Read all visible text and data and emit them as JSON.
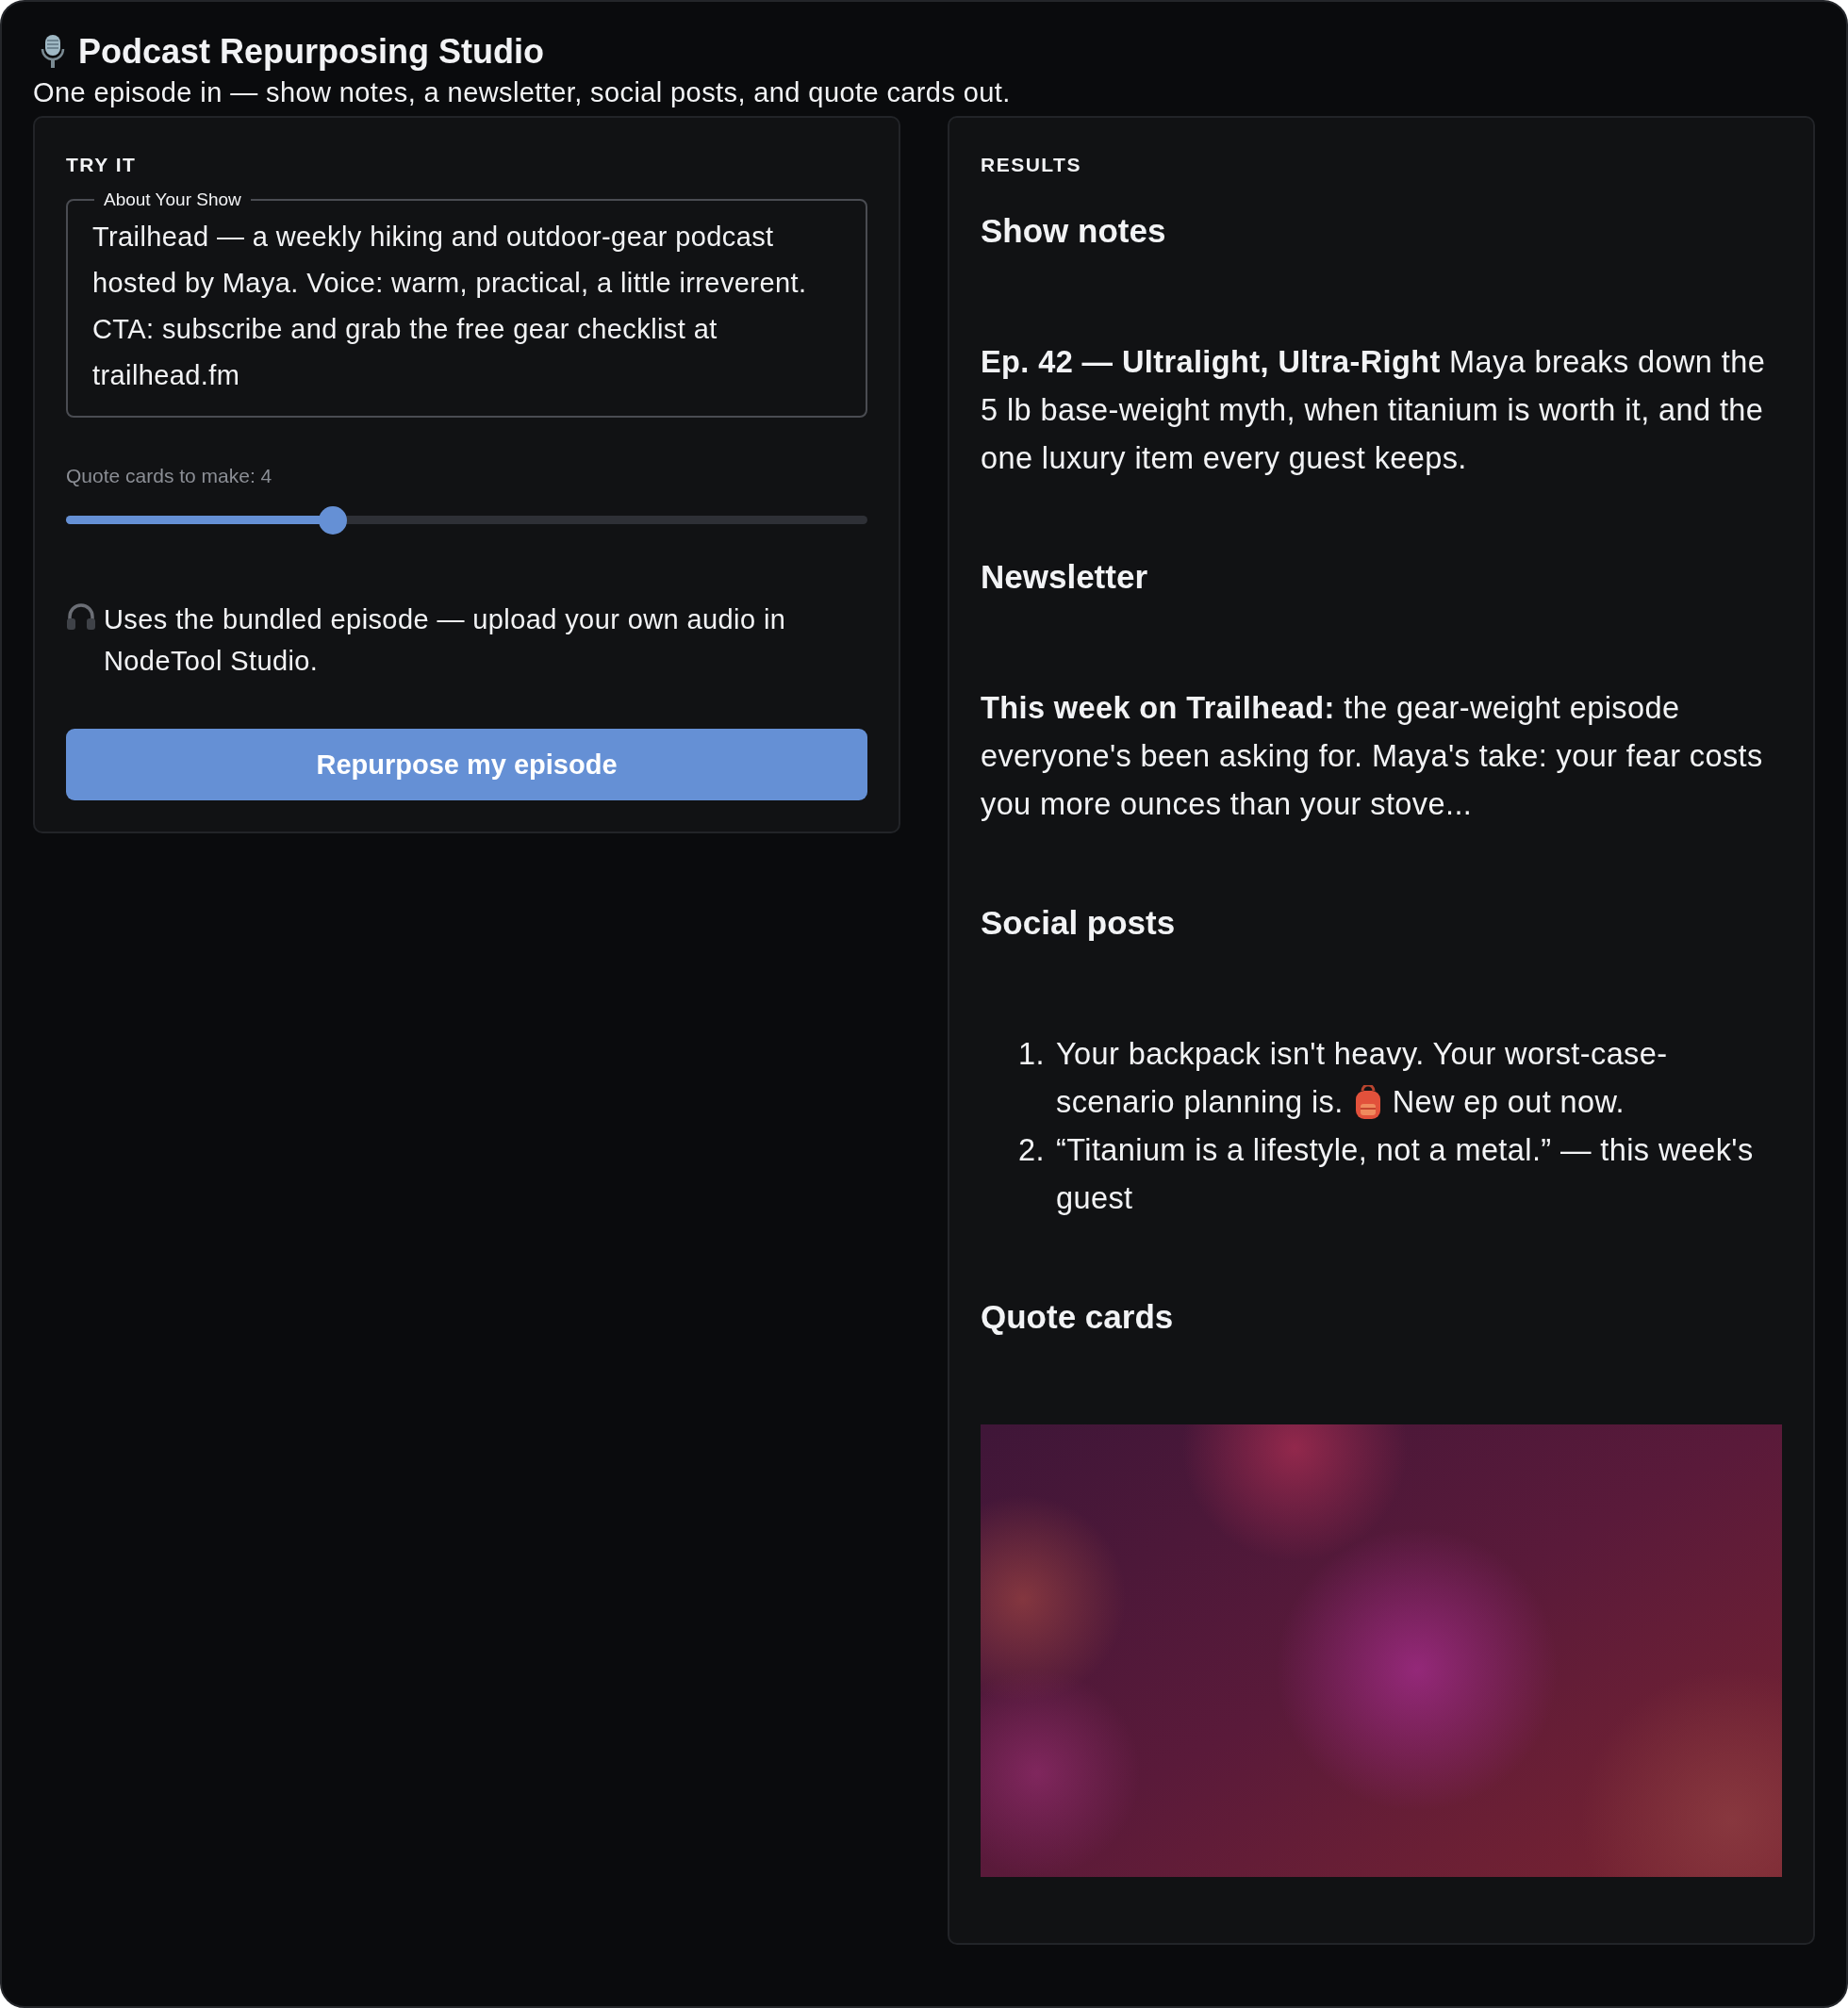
{
  "header": {
    "title": "Podcast Repurposing Studio",
    "subtitle": "One episode in — show notes, a newsletter, social posts, and quote cards out."
  },
  "try_it": {
    "label": "TRY IT",
    "show_field": {
      "label": "About Your Show",
      "value": "Trailhead — a weekly hiking and outdoor-gear podcast hosted by Maya. Voice: warm, practical, a little irreverent. CTA: subscribe and grab the free gear checklist at trailhead.fm"
    },
    "slider": {
      "label": "Quote cards to make: 4",
      "level": 0.333
    },
    "note": "Uses the bundled episode — upload your own audio in NodeTool Studio.",
    "button": "Repurpose my episode"
  },
  "results": {
    "label": "RESULTS",
    "sections": [
      {
        "kind": "paragraph",
        "heading": "Show notes",
        "text": "**Ep. 42 — Ultralight, Ultra-Right** Maya breaks down the 5 lb base-weight myth, when titanium is worth it, and the one luxury item every guest keeps."
      },
      {
        "kind": "paragraph",
        "heading": "Newsletter",
        "text": "**This week on Trailhead:** the gear-weight episode everyone's been asking for. Maya's take: your fear costs you more ounces than your stove..."
      },
      {
        "kind": "list",
        "heading": "Social posts",
        "items": [
          {
            "number": "1.",
            "text": "Your backpack isn't heavy. Your worst-case-",
            "line_2": "scenario planning is.",
            "after_icon": "New ep out now."
          },
          {
            "number": "2.",
            "text": "“Titanium is a lifestyle, not a metal.” — this week's guest"
          }
        ]
      },
      {
        "kind": "images",
        "heading": "Quote cards"
      }
    ]
  }
}
